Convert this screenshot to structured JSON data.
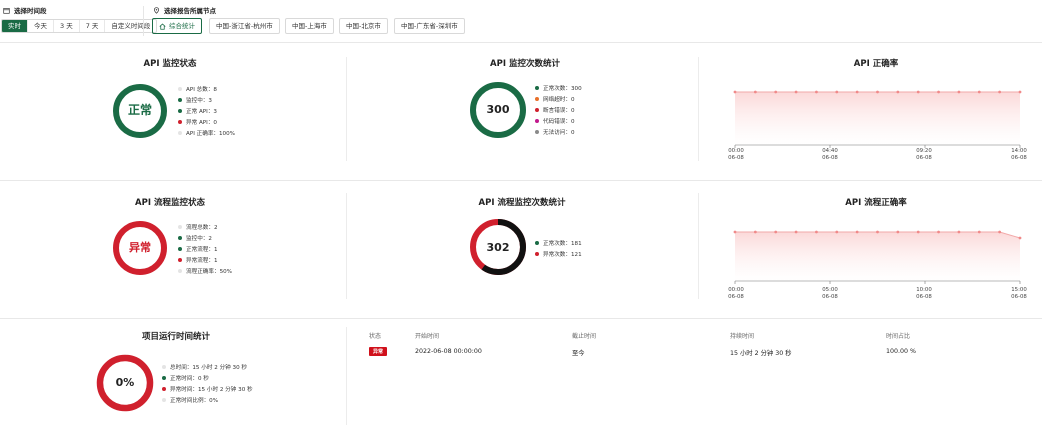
{
  "filters": {
    "time_label": "选择时间段",
    "time_options": [
      "实时",
      "今天",
      "3 天",
      "7 天",
      "自定义时间段"
    ],
    "time_active": "实时",
    "node_label": "选择报告所属节点",
    "nodes": [
      "综合统计",
      "中国-浙江省-杭州市",
      "中国-上海市",
      "中国-北京市",
      "中国-广东省-深圳市"
    ],
    "node_active": "综合统计"
  },
  "api_status": {
    "title": "API 监控状态",
    "center": "正常",
    "legend": [
      {
        "label": "API 总数：8",
        "color": "#e4e4e4"
      },
      {
        "label": "监控中：3",
        "color": "#1a6b45"
      },
      {
        "label": "正常 API：3",
        "color": "#1a6b45"
      },
      {
        "label": "异常 API：0",
        "color": "#d0202d"
      },
      {
        "label": "API 正确率：100%",
        "color": "#e4e4e4"
      }
    ],
    "ring_color": "#1a6b45"
  },
  "api_count": {
    "title": "API 监控次数统计",
    "center": "300",
    "legend": [
      {
        "label": "正常次数：300",
        "color": "#1a6b45"
      },
      {
        "label": "网络超时：0",
        "color": "#e8702a"
      },
      {
        "label": "断言错误：0",
        "color": "#d0202d"
      },
      {
        "label": "代码错误：0",
        "color": "#c2188c"
      },
      {
        "label": "无法访问：0",
        "color": "#8a8a8a"
      }
    ],
    "ring_color": "#1a6b45"
  },
  "api_rate": {
    "title": "API 正确率",
    "x_labels": [
      [
        "00:00",
        "06-08"
      ],
      [
        "04:40",
        "06-08"
      ],
      [
        "09:20",
        "06-08"
      ],
      [
        "14:00",
        "06-08"
      ]
    ]
  },
  "flow_status": {
    "title": "API 流程监控状态",
    "center": "异常",
    "legend": [
      {
        "label": "流程总数：2",
        "color": "#e4e4e4"
      },
      {
        "label": "监控中：2",
        "color": "#1a6b45"
      },
      {
        "label": "正常流程：1",
        "color": "#1a6b45"
      },
      {
        "label": "异常流程：1",
        "color": "#d0202d"
      },
      {
        "label": "流程正确率：50%",
        "color": "#e4e4e4"
      }
    ],
    "ring_color": "#d0202d"
  },
  "flow_count": {
    "title": "API 流程监控次数统计",
    "center": "302",
    "legend": [
      {
        "label": "正常次数：181",
        "color": "#1a6b45"
      },
      {
        "label": "异常次数：121",
        "color": "#d0202d"
      }
    ],
    "normal": 181,
    "abnormal": 121
  },
  "flow_rate": {
    "title": "API 流程正确率",
    "x_labels": [
      [
        "00:00",
        "06-08"
      ],
      [
        "05:00",
        "06-08"
      ],
      [
        "10:00",
        "06-08"
      ],
      [
        "15:00",
        "06-08"
      ]
    ]
  },
  "project_time": {
    "title": "项目运行时间统计",
    "center": "0%",
    "legend": [
      {
        "label": "总时间：15 小时 2 分钟 30 秒",
        "color": "#e4e4e4"
      },
      {
        "label": "正常时间：0 秒",
        "color": "#1a6b45"
      },
      {
        "label": "异常时间：15 小时 2 分钟 30 秒",
        "color": "#d0202d"
      },
      {
        "label": "正常时间比例：0%",
        "color": "#e4e4e4"
      }
    ],
    "ring_color": "#d0202d"
  },
  "table": {
    "headers": [
      "状态",
      "开始时间",
      "截止时间",
      "持续时间",
      "时间占比"
    ],
    "row": {
      "status": "异常",
      "start": "2022-06-08 00:00:00",
      "end": "至今",
      "duration": "15 小时 2 分钟 30 秒",
      "ratio": "100.00 %"
    }
  }
}
